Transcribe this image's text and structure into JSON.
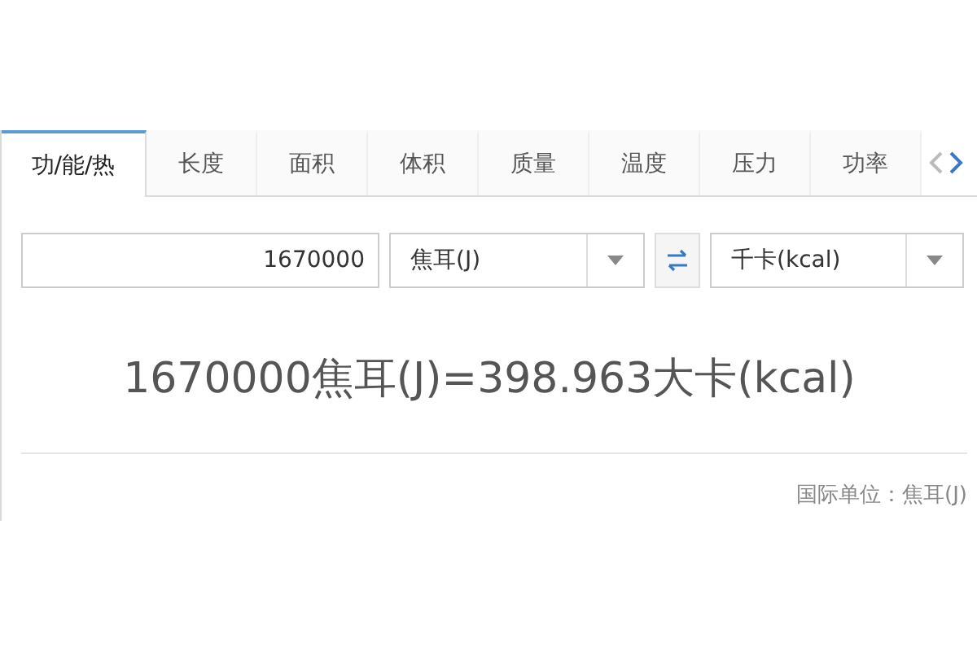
{
  "tabs": [
    {
      "label": "功/能/热",
      "selected": true
    },
    {
      "label": "长度",
      "selected": false
    },
    {
      "label": "面积",
      "selected": false
    },
    {
      "label": "体积",
      "selected": false
    },
    {
      "label": "质量",
      "selected": false
    },
    {
      "label": "温度",
      "selected": false
    },
    {
      "label": "压力",
      "selected": false
    },
    {
      "label": "功率",
      "selected": false
    }
  ],
  "converter": {
    "value": "1670000",
    "from_unit": "焦耳(J)",
    "to_unit": "千卡(kcal)"
  },
  "result": "1670000焦耳(J)=398.963大卡(kcal)",
  "footer": "国际单位：焦耳(J)"
}
